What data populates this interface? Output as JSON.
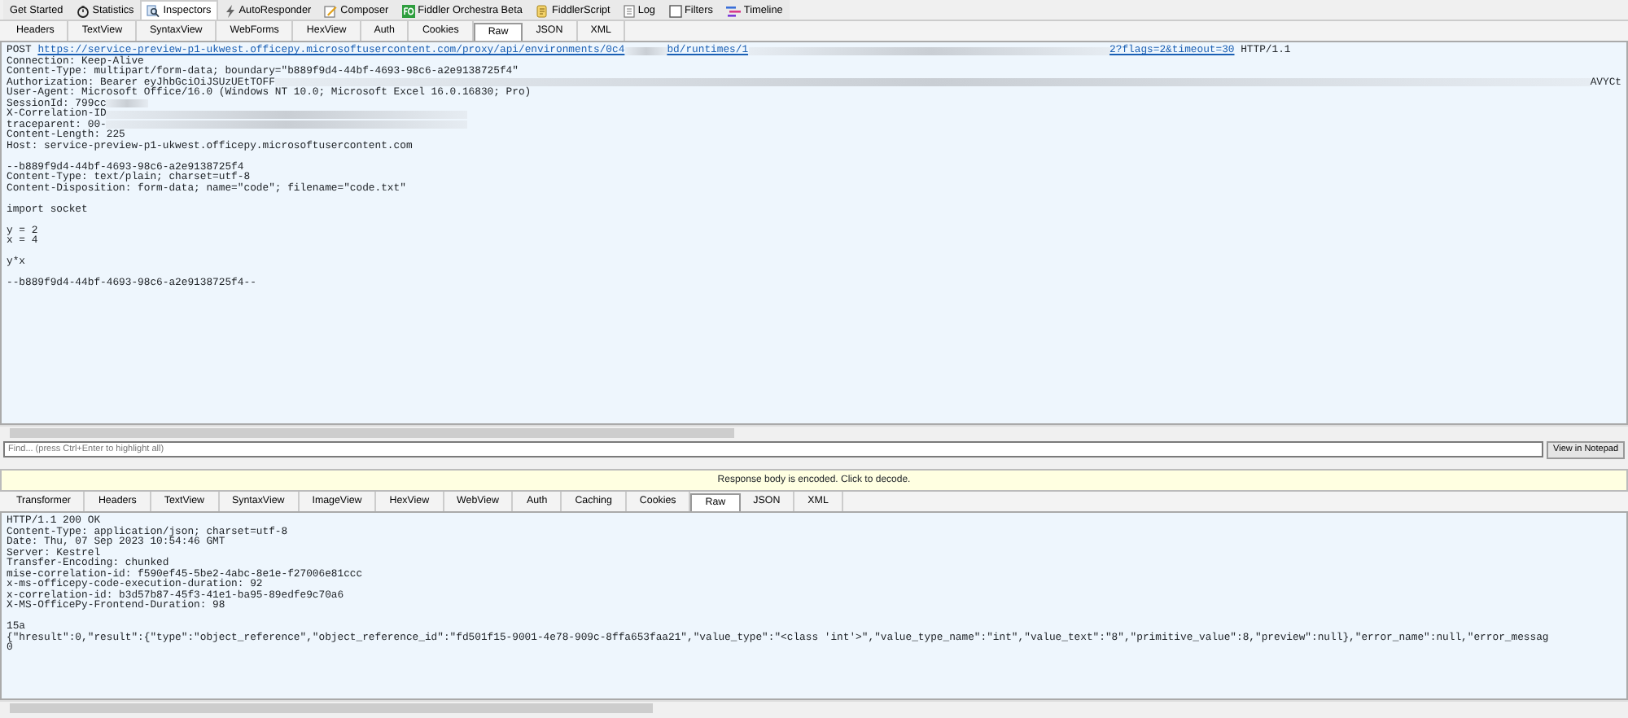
{
  "main_tabs": [
    {
      "label": "Get Started",
      "selected": false
    },
    {
      "label": "Statistics",
      "selected": false
    },
    {
      "label": "Inspectors",
      "selected": true
    },
    {
      "label": "AutoResponder",
      "selected": false
    },
    {
      "label": "Composer",
      "selected": false
    },
    {
      "label": "Fiddler Orchestra Beta",
      "selected": false
    },
    {
      "label": "FiddlerScript",
      "selected": false
    },
    {
      "label": "Log",
      "selected": false
    },
    {
      "label": "Filters",
      "selected": false
    },
    {
      "label": "Timeline",
      "selected": false
    }
  ],
  "request": {
    "tabs": [
      {
        "label": "Headers",
        "selected": false
      },
      {
        "label": "TextView",
        "selected": false
      },
      {
        "label": "SyntaxView",
        "selected": false
      },
      {
        "label": "WebForms",
        "selected": false
      },
      {
        "label": "HexView",
        "selected": false
      },
      {
        "label": "Auth",
        "selected": false
      },
      {
        "label": "Cookies",
        "selected": false
      },
      {
        "label": "Raw",
        "selected": true
      },
      {
        "label": "JSON",
        "selected": false
      },
      {
        "label": "XML",
        "selected": false
      }
    ],
    "lines": [
      {
        "parts": [
          {
            "kind": "plain",
            "text": "POST "
          },
          {
            "kind": "link",
            "text": "https://service-preview-p1-ukwest.officepy.microsoftusercontent.com/proxy/api/environments/0c4"
          },
          {
            "kind": "redacted"
          },
          {
            "kind": "link",
            "text": "bd/runtimes/1"
          },
          {
            "kind": "redacted-wide"
          },
          {
            "kind": "link",
            "text": "2?flags=2&timeout=30"
          },
          {
            "kind": "plain",
            "text": " HTTP/1.1"
          }
        ]
      },
      {
        "parts": [
          {
            "kind": "plain",
            "text": "Connection: Keep-Alive"
          }
        ]
      },
      {
        "parts": [
          {
            "kind": "plain",
            "text": "Content-Type: multipart/form-data; boundary=\"b889f9d4-44bf-4693-98c6-a2e9138725f4\""
          }
        ]
      },
      {
        "parts": [
          {
            "kind": "plain",
            "text": "Authorization: Bearer eyJhbGciOiJSUzUEtTOFF"
          },
          {
            "kind": "redacted-fill"
          },
          {
            "kind": "plain",
            "text": "AVYCt"
          }
        ]
      },
      {
        "parts": [
          {
            "kind": "plain",
            "text": "User-Agent: Microsoft Office/16.0 (Windows NT 10.0; Microsoft Excel 16.0.16830; Pro)"
          }
        ]
      },
      {
        "parts": [
          {
            "kind": "plain",
            "text": "SessionId: 799cc"
          },
          {
            "kind": "redacted"
          }
        ]
      },
      {
        "parts": [
          {
            "kind": "plain",
            "text": "X-Correlation-ID"
          },
          {
            "kind": "redacted-wide"
          }
        ]
      },
      {
        "parts": [
          {
            "kind": "plain",
            "text": "traceparent: 00-"
          },
          {
            "kind": "redacted-wide"
          }
        ]
      },
      {
        "parts": [
          {
            "kind": "plain",
            "text": "Content-Length: 225"
          }
        ]
      },
      {
        "parts": [
          {
            "kind": "plain",
            "text": "Host: service-preview-p1-ukwest.officepy.microsoftusercontent.com"
          }
        ]
      },
      {
        "space_before": true,
        "parts": [
          {
            "kind": "plain",
            "text": "--b889f9d4-44bf-4693-98c6-a2e9138725f4"
          }
        ]
      },
      {
        "parts": [
          {
            "kind": "plain",
            "text": "Content-Type: text/plain; charset=utf-8"
          }
        ]
      },
      {
        "parts": [
          {
            "kind": "plain",
            "text": "Content-Disposition: form-data; name=\"code\"; filename=\"code.txt\""
          }
        ]
      },
      {
        "space_before": true,
        "parts": [
          {
            "kind": "plain",
            "text": "import socket"
          }
        ]
      },
      {
        "space_before": true,
        "parts": [
          {
            "kind": "plain",
            "text": "y = 2"
          }
        ]
      },
      {
        "parts": [
          {
            "kind": "plain",
            "text": "x = 4"
          }
        ]
      },
      {
        "space_before": true,
        "parts": [
          {
            "kind": "plain",
            "text": "y*x"
          }
        ]
      },
      {
        "space_before": true,
        "parts": [
          {
            "kind": "plain",
            "text": "--b889f9d4-44bf-4693-98c6-a2e9138725f4--"
          }
        ]
      }
    ],
    "find_placeholder": "Find... (press Ctrl+Enter to highlight all)",
    "notepad_button": "View in Notepad"
  },
  "encoded_banner": "Response body is encoded. Click to decode.",
  "response": {
    "tabs": [
      {
        "label": "Transformer",
        "selected": false
      },
      {
        "label": "Headers",
        "selected": false
      },
      {
        "label": "TextView",
        "selected": false
      },
      {
        "label": "SyntaxView",
        "selected": false
      },
      {
        "label": "ImageView",
        "selected": false
      },
      {
        "label": "HexView",
        "selected": false
      },
      {
        "label": "WebView",
        "selected": false
      },
      {
        "label": "Auth",
        "selected": false
      },
      {
        "label": "Caching",
        "selected": false
      },
      {
        "label": "Cookies",
        "selected": false
      },
      {
        "label": "Raw",
        "selected": true
      },
      {
        "label": "JSON",
        "selected": false
      },
      {
        "label": "XML",
        "selected": false
      }
    ],
    "lines": [
      {
        "text": "HTTP/1.1 200 OK"
      },
      {
        "text": "Content-Type: application/json; charset=utf-8"
      },
      {
        "text": "Date: Thu, 07 Sep 2023 10:54:46 GMT"
      },
      {
        "text": "Server: Kestrel"
      },
      {
        "text": "Transfer-Encoding: chunked"
      },
      {
        "text": "mise-correlation-id: f590ef45-5be2-4abc-8e1e-f27006e81ccc"
      },
      {
        "text": "x-ms-officepy-code-execution-duration: 92"
      },
      {
        "text": "x-correlation-id: b3d57b87-45f3-41e1-ba95-89edfe9c70a6"
      },
      {
        "text": "X-MS-OfficePy-Frontend-Duration: 98"
      },
      {
        "space_before": true,
        "text": "15a"
      },
      {
        "text": "{\"hresult\":0,\"result\":{\"type\":\"object_reference\",\"object_reference_id\":\"fd501f15-9001-4e78-909c-8ffa653faa21\",\"value_type\":\"<class 'int'>\",\"value_type_name\":\"int\",\"value_text\":\"8\",\"primitive_value\":8,\"preview\":null},\"error_name\":null,\"error_messag"
      },
      {
        "text": "0"
      }
    ]
  }
}
